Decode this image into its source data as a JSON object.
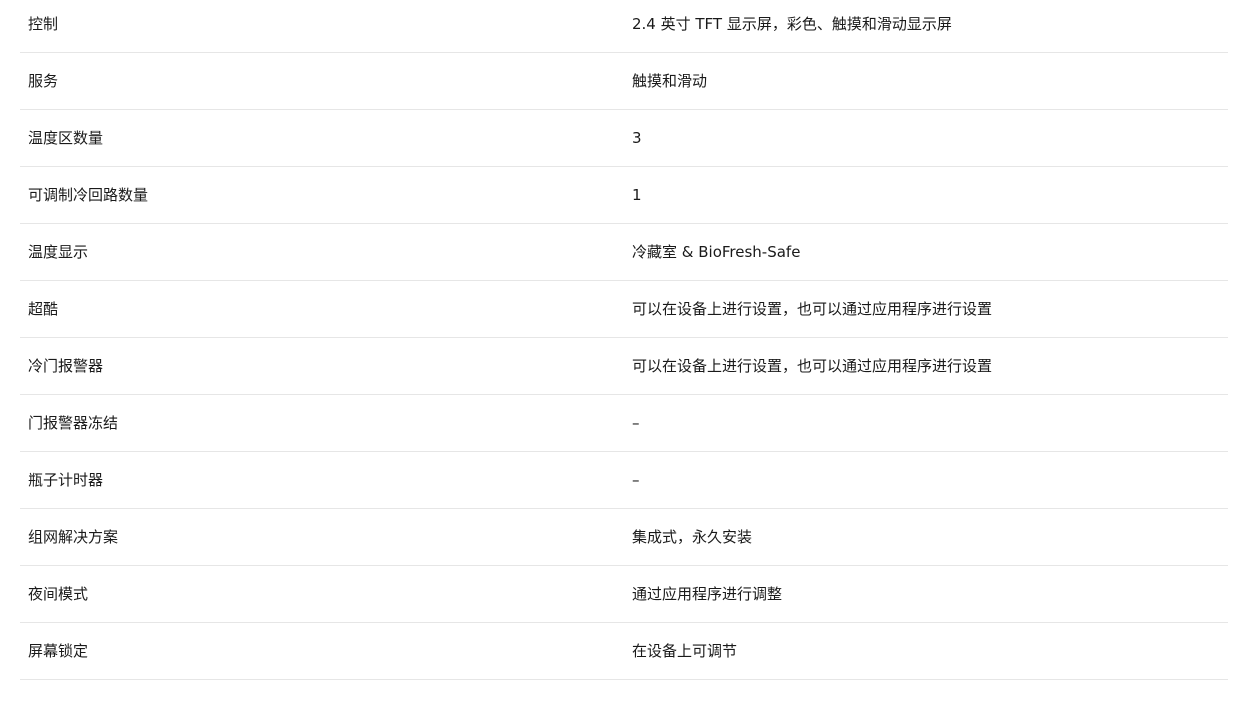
{
  "specs": {
    "rows": [
      {
        "label": "控制",
        "value": "2.4 英寸 TFT 显示屏，彩色、触摸和滑动显示屏"
      },
      {
        "label": "服务",
        "value": "触摸和滑动"
      },
      {
        "label": "温度区数量",
        "value": "3"
      },
      {
        "label": "可调制冷回路数量",
        "value": "1"
      },
      {
        "label": "温度显示",
        "value": "冷藏室 & BioFresh-Safe"
      },
      {
        "label": "超酷",
        "value": "可以在设备上进行设置，也可以通过应用程序进行设置"
      },
      {
        "label": "冷门报警器",
        "value": "可以在设备上进行设置，也可以通过应用程序进行设置"
      },
      {
        "label": "门报警器冻结",
        "value": "–"
      },
      {
        "label": "瓶子计时器",
        "value": "–"
      },
      {
        "label": "组网解决方案",
        "value": "集成式，永久安装"
      },
      {
        "label": "夜间模式",
        "value": "通过应用程序进行调整"
      },
      {
        "label": "屏幕锁定",
        "value": "在设备上可调节"
      }
    ]
  }
}
